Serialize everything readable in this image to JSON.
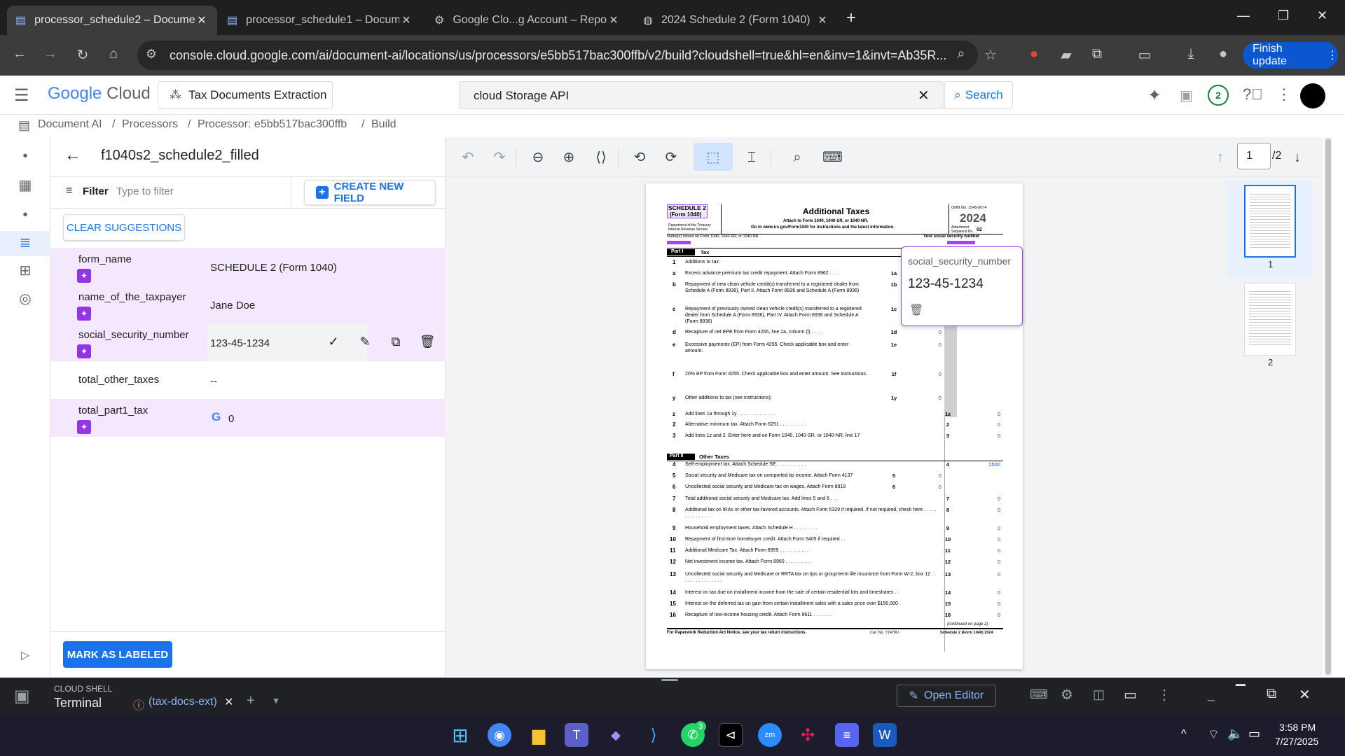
{
  "browser": {
    "tabs": [
      {
        "title": "processor_schedule2 – Docume",
        "active": true
      },
      {
        "title": "processor_schedule1 – Docume",
        "active": false
      },
      {
        "title": "Google Clo...g Account – Repor",
        "active": false
      },
      {
        "title": "2024 Schedule 2 (Form 1040)",
        "active": false
      }
    ],
    "url": "console.cloud.google.com/ai/document-ai/locations/us/processors/e5bb517bac300ffb/v2/build?cloudshell=true&hl=en&inv=1&invt=Ab35R...",
    "finish_update": "Finish update",
    "new_tab": "+",
    "win_min": "—",
    "win_max": "❐",
    "win_close": "✕"
  },
  "gcp": {
    "logo_google": "Google",
    "logo_cloud": "Cloud",
    "project": "Tax Documents Extraction",
    "search_value": "cloud Storage API",
    "search_button": "Search",
    "notif_count": "2",
    "breadcrumb": [
      "Document AI",
      "/",
      "Processors",
      "/",
      "Processor: e5bb517bac300ffb",
      "/",
      "Build"
    ]
  },
  "panel": {
    "doc_title": "f1040s2_schedule2_filled",
    "filter_label": "Filter",
    "filter_placeholder": "Type to filter",
    "create_field": "CREATE NEW FIELD",
    "clear_suggestions": "CLEAR SUGGESTIONS",
    "fields": [
      {
        "name": "form_name",
        "value": "SCHEDULE 2 (Form 1040)"
      },
      {
        "name": "name_of_the_taxpayer",
        "value": "Jane Doe"
      },
      {
        "name": "social_security_number",
        "value": "123-45-1234"
      },
      {
        "name": "total_other_taxes",
        "value": "--"
      },
      {
        "name": "total_part1_tax",
        "value": "0"
      }
    ],
    "mark_labeled": "MARK AS LABELED"
  },
  "viewer": {
    "page_current": "1",
    "page_total": "/2",
    "thumb_labels": [
      "1",
      "2"
    ],
    "tooltip": {
      "field": "social_security_number",
      "value": "123-45-1234"
    }
  },
  "document": {
    "schedule_tag": "SCHEDULE 2",
    "form_tag": "(Form 1040)",
    "dept": "Department of the Treasury",
    "irs": "Internal Revenue Service",
    "title": "Additional Taxes",
    "subtitle1": "Attach to Form 1040, 1040-SR, or 1040-NR.",
    "subtitle2": "Go to www.irs.gov/Form1040 for instructions and the latest information.",
    "omb": "OMB No. 1545-0074",
    "year": "2024",
    "attach1": "Attachment",
    "attach2": "Sequence No.",
    "seq": "02",
    "name_label": "Name(s) shown on Form 1040, 1040-SR, or 1040-NR",
    "ssn_label": "Your social security number",
    "part1": "Part I",
    "part1_title": "Tax",
    "part2": "Part II",
    "part2_title": "Other Taxes",
    "footer_left": "For Paperwork Reduction Act Notice, see your tax return instructions.",
    "footer_cat": "Cat. No. 71478U",
    "footer_right": "Schedule 2 (Form 1040) 2024",
    "continued": "(continued on page 2)",
    "lines": [
      {
        "n": "1",
        "t": "Additions to tax:",
        "box": "",
        "amt": ""
      },
      {
        "n": "a",
        "t": "Excess advance premium tax credit repayment. Attach Form 8962 . . . .",
        "box": "1a",
        "amt": ""
      },
      {
        "n": "b",
        "t": "Repayment of new clean vehicle credit(s) transferred to a registered dealer from Schedule A (Form 8936), Part II. Attach Form 8936 and Schedule A (Form 8936)",
        "box": "1b",
        "amt": ""
      },
      {
        "n": "c",
        "t": "Repayment of previously owned clean vehicle credit(s) transferred to a registered dealer from Schedule A (Form 8936), Part IV. Attach Form 8936 and Schedule A (Form 8936)",
        "box": "1c",
        "amt": ""
      },
      {
        "n": "d",
        "t": "Recapture of net EPE from Form 4255, line 2a, column (l) . . . .",
        "box": "1d",
        "amt": "0"
      },
      {
        "n": "e",
        "t": "Excessive payments (EP) from Form 4255. Check applicable box and enter amount.",
        "box": "1e",
        "amt": "0"
      },
      {
        "n": "f",
        "t": "20% EP from Form 4255. Check applicable box and enter amount. See instructions.",
        "box": "1f",
        "amt": "0"
      },
      {
        "n": "y",
        "t": "Other additions to tax (see instructions):",
        "box": "1y",
        "amt": "0"
      },
      {
        "n": "z",
        "t": "Add lines 1a through 1y . . . . . . . . . . . . . .",
        "box": "1z",
        "amt": "0"
      },
      {
        "n": "2",
        "t": "Alternative minimum tax. Attach Form 6251 . . . . . . . . . .",
        "box": "2",
        "amt": "0"
      },
      {
        "n": "3",
        "t": "Add lines 1z and 2. Enter here and on Form 1040, 1040-SR, or 1040-NR, line 17",
        "box": "3",
        "amt": "0"
      },
      {
        "n": "4",
        "t": "Self-employment tax. Attach Schedule SE . . . . . . . . . . .",
        "box": "4",
        "amt": "2500"
      },
      {
        "n": "5",
        "t": "Social security and Medicare tax on unreported tip income. Attach Form 4137",
        "box": "5",
        "amt": "0"
      },
      {
        "n": "6",
        "t": "Uncollected social security and Medicare tax on wages. Attach Form 8919",
        "box": "6",
        "amt": "0"
      },
      {
        "n": "7",
        "t": "Total additional social security and Medicare tax. Add lines 5 and 6 . . .",
        "box": "7",
        "amt": "0"
      },
      {
        "n": "8",
        "t": "Additional tax on IRAs or other tax-favored accounts. Attach Form 5329 if required. If not required, check here . . . . . . . . . . . . . . .",
        "box": "8",
        "amt": "0"
      },
      {
        "n": "9",
        "t": "Household employment taxes. Attach Schedule H . . . . . . . . .",
        "box": "9",
        "amt": "0"
      },
      {
        "n": "10",
        "t": "Repayment of first-time homebuyer credit. Attach Form 5405 if required . .",
        "box": "10",
        "amt": "0"
      },
      {
        "n": "11",
        "t": "Additional Medicare Tax. Attach Form 8959 . . . . . . . . . . .",
        "box": "11",
        "amt": "0"
      },
      {
        "n": "12",
        "t": "Net investment income tax. Attach Form 8960 . . . . . . . . . .",
        "box": "12",
        "amt": "0"
      },
      {
        "n": "13",
        "t": "Uncollected social security and Medicare or RRTA tax on tips or group-term life insurance from Form W-2, box 12 . . . . . . . . . . . . . . . .",
        "box": "13",
        "amt": "0"
      },
      {
        "n": "14",
        "t": "Interest on tax due on installment income from the sale of certain residential lots and timeshares . .",
        "box": "14",
        "amt": "0"
      },
      {
        "n": "15",
        "t": "Interest on the deferred tax on gain from certain installment sales with a sales price over $150,000 .",
        "box": "15",
        "amt": "0"
      },
      {
        "n": "16",
        "t": "Recapture of low-income housing credit. Attach Form 8611 . . . . . . .",
        "box": "16",
        "amt": "0"
      }
    ]
  },
  "shell": {
    "label": "CLOUD SHELL",
    "terminal": "Terminal",
    "session": "(tax-docs-ext)",
    "open_editor": "Open Editor"
  },
  "taskbar": {
    "time": "3:58 PM",
    "date": "7/27/2025",
    "whatsapp_badge": "3"
  },
  "colors": {
    "accent": "#1a73e8",
    "suggestion_bg": "#f3e8fd",
    "sparkle": "#9334e6",
    "chrome_dark": "#1f1f1f"
  }
}
